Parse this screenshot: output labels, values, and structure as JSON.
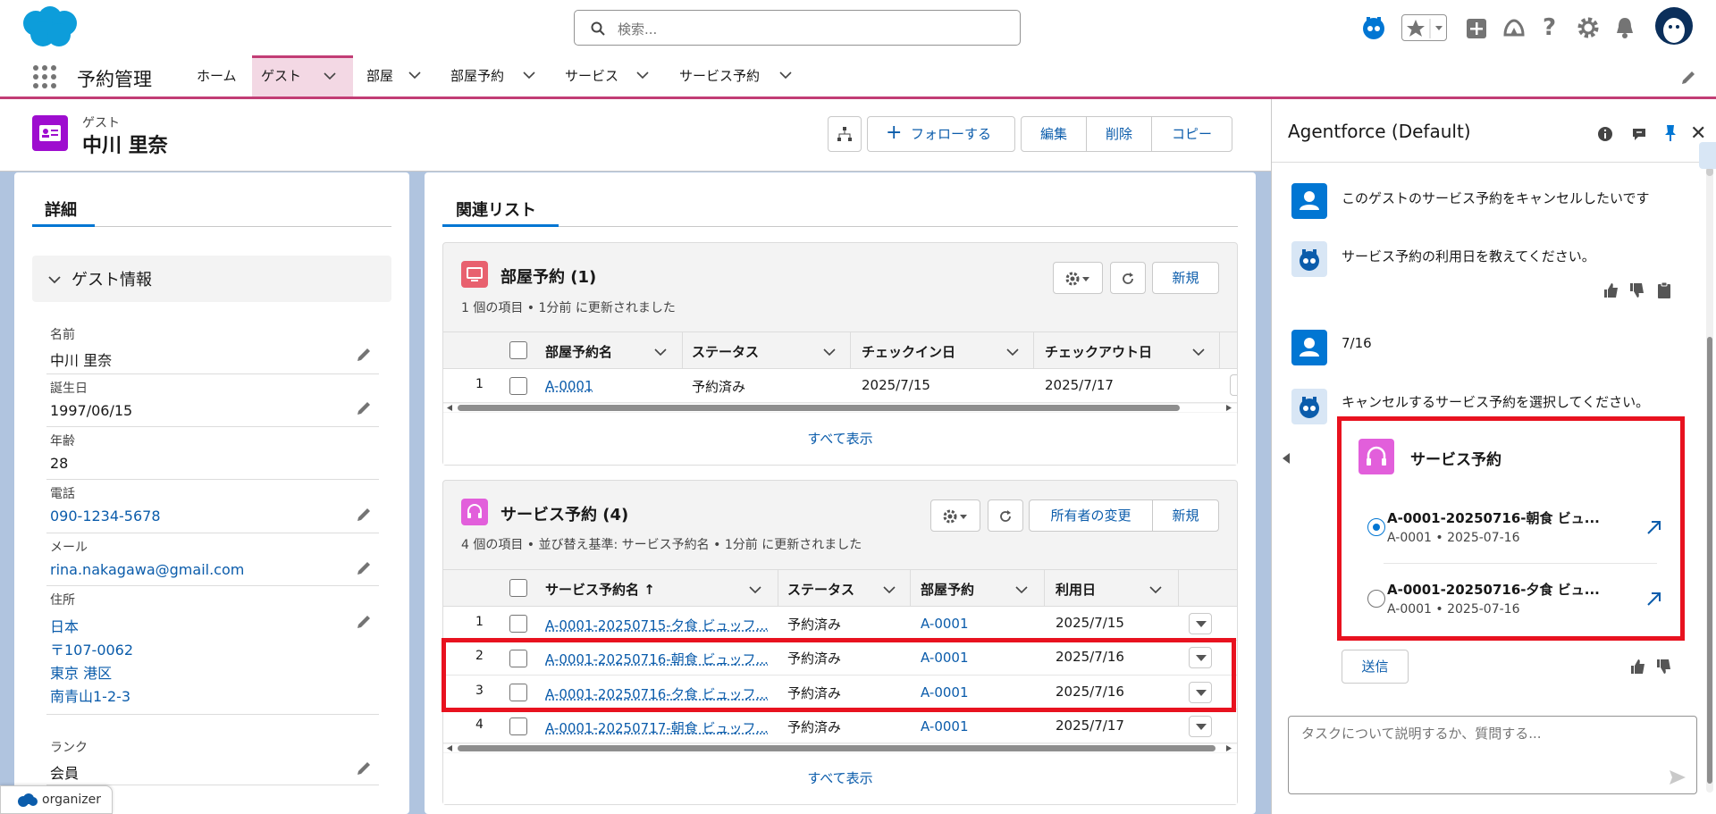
{
  "header": {
    "search_placeholder": "検索...",
    "icons": [
      "salesforce-cloud-logo",
      "einstein-icon",
      "favorites-star-icon",
      "add-icon",
      "trailhead-icon",
      "help-icon",
      "setup-gear-icon",
      "notification-bell-icon",
      "user-avatar"
    ]
  },
  "nav": {
    "app_name": "予約管理",
    "tabs": [
      {
        "label": "ホーム",
        "has_menu": false
      },
      {
        "label": "ゲスト",
        "has_menu": true,
        "active": true
      },
      {
        "label": "部屋",
        "has_menu": true
      },
      {
        "label": "部屋予約",
        "has_menu": true
      },
      {
        "label": "サービス",
        "has_menu": true
      },
      {
        "label": "サービス予約",
        "has_menu": true
      }
    ]
  },
  "record": {
    "object_label": "ゲスト",
    "name": "中川 里奈",
    "actions": {
      "follow": "フォローする",
      "edit": "編集",
      "delete": "削除",
      "copy": "コピー"
    }
  },
  "details": {
    "tab": "詳細",
    "section": "ゲスト情報",
    "fields": {
      "name": {
        "label": "名前",
        "value": "中川 里奈"
      },
      "birthday": {
        "label": "誕生日",
        "value": "1997/06/15"
      },
      "age": {
        "label": "年齢",
        "value": "28"
      },
      "phone": {
        "label": "電話",
        "value": "090-1234-5678"
      },
      "email": {
        "label": "メール",
        "value": "rina.nakagawa@gmail.com"
      },
      "address": {
        "label": "住所",
        "lines": [
          "日本",
          "〒107-0062",
          "東京 港区",
          "南青山1-2-3"
        ]
      },
      "rank": {
        "label": "ランク",
        "value": "会員"
      }
    }
  },
  "related": {
    "tab": "関連リスト",
    "room_reservations": {
      "title": "部屋予約 (1)",
      "subtitle": "1 個の項目 • 1分前 に更新されました",
      "new": "新規",
      "columns": [
        "部屋予約名",
        "ステータス",
        "チェックイン日",
        "チェックアウト日"
      ],
      "rows": [
        {
          "num": "1",
          "name": "A-0001",
          "status": "予約済み",
          "checkin": "2025/7/15",
          "checkout": "2025/7/17"
        }
      ],
      "view_all": "すべて表示"
    },
    "service_reservations": {
      "title": "サービス予約 (4)",
      "subtitle": "4 個の項目 • 並び替え基準: サービス予約名 • 1分前 に更新されました",
      "change_owner": "所有者の変更",
      "new": "新規",
      "columns": [
        "サービス予約名 ↑",
        "ステータス",
        "部屋予約",
        "利用日"
      ],
      "rows": [
        {
          "num": "1",
          "name": "A-0001-20250715-夕食 ビュッフ...",
          "status": "予約済み",
          "room": "A-0001",
          "date": "2025/7/15"
        },
        {
          "num": "2",
          "name": "A-0001-20250716-朝食 ビュッフ...",
          "status": "予約済み",
          "room": "A-0001",
          "date": "2025/7/16"
        },
        {
          "num": "3",
          "name": "A-0001-20250716-夕食 ビュッフ...",
          "status": "予約済み",
          "room": "A-0001",
          "date": "2025/7/16"
        },
        {
          "num": "4",
          "name": "A-0001-20250717-朝食 ビュッフ...",
          "status": "予約済み",
          "room": "A-0001",
          "date": "2025/7/17"
        }
      ],
      "view_all": "すべて表示"
    }
  },
  "agent": {
    "title": "Agentforce (Default)",
    "messages": [
      {
        "from": "user",
        "text": "このゲストのサービス予約をキャンセルしたいです"
      },
      {
        "from": "agent",
        "text": "サービス予約の利用日を教えてください。"
      },
      {
        "from": "user",
        "text": "7/16"
      },
      {
        "from": "agent",
        "text": "キャンセルするサービス予約を選択してください。"
      }
    ],
    "selection_card": {
      "title": "サービス予約",
      "options": [
        {
          "title": "A-0001-20250716-朝食 ビュ...",
          "meta": "A-0001 • 2025-07-16",
          "selected": true
        },
        {
          "title": "A-0001-20250716-夕食 ビュ...",
          "meta": "A-0001 • 2025-07-16",
          "selected": false
        }
      ]
    },
    "send_button": "送信",
    "input_placeholder": "タスクについて説明するか、質問する..."
  },
  "footer": {
    "organizer": "organizer"
  },
  "colors": {
    "accent": "#c23d75",
    "brand": "#0176d3",
    "highlight": "#e8121f",
    "guest_icon": "#9e0dcf",
    "service_icon": "#e25fdb",
    "room_icon": "#e8616f"
  }
}
